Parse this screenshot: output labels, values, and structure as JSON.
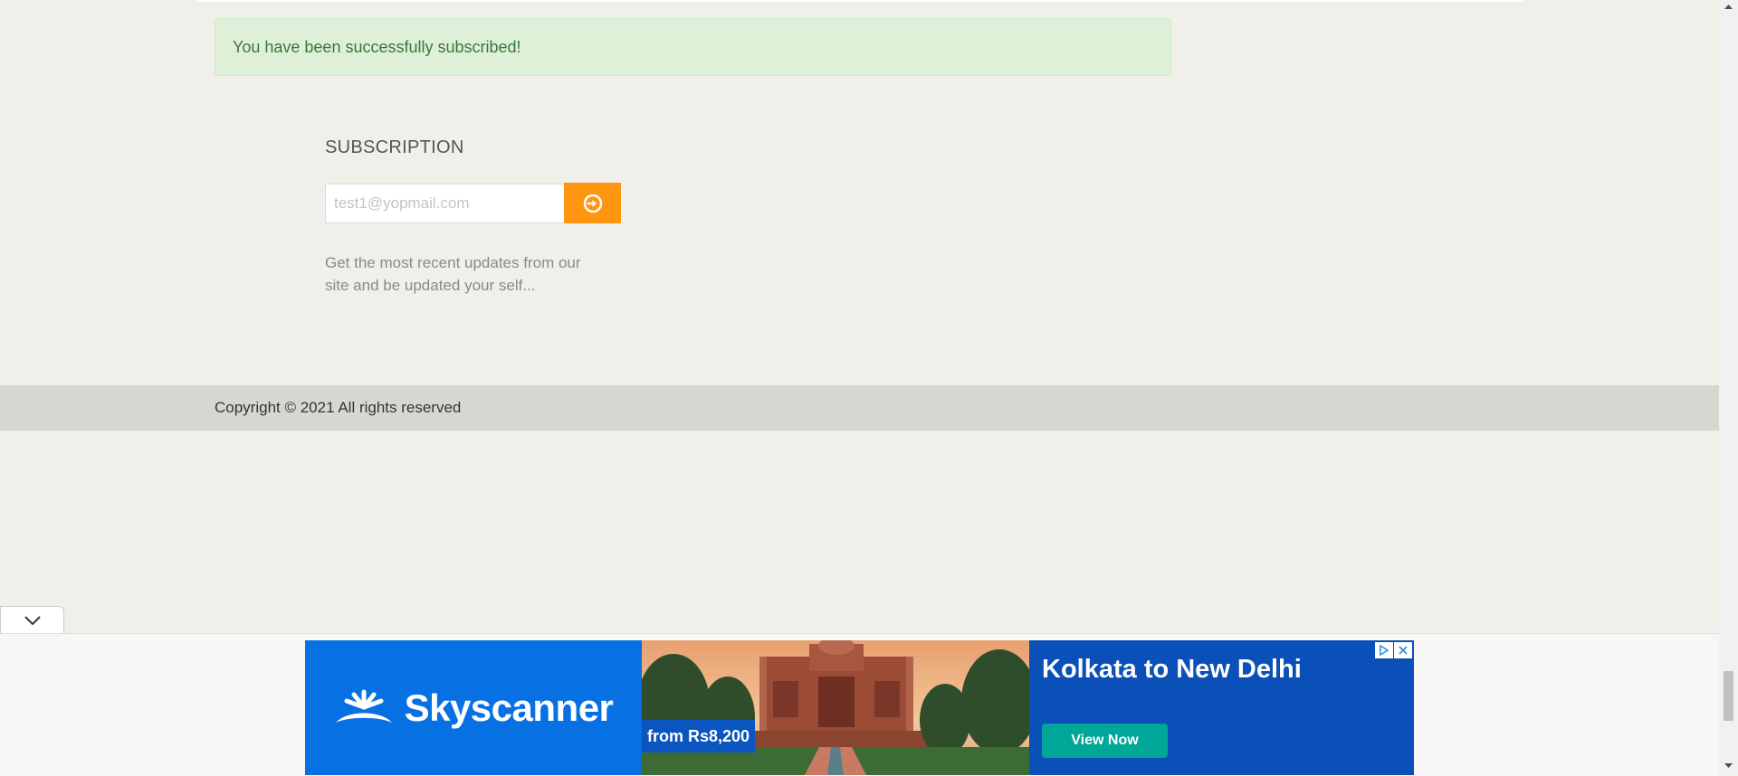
{
  "alert": {
    "message": "You have been successfully subscribed!"
  },
  "subscription": {
    "title": "SUBSCRIPTION",
    "email_value": "test1@yopmail.com",
    "submit_icon": "arrow-circle-right-icon",
    "description": "Get the most recent updates from our site and be updated your self..."
  },
  "footer": {
    "copyright": "Copyright © 2021 All rights reserved"
  },
  "collapse": {
    "icon": "chevron-down-icon"
  },
  "ad": {
    "brand": "Skyscanner",
    "price": "from Rs8,200",
    "route": "Kolkata to New Delhi",
    "cta": "View Now",
    "controls": [
      "adchoices-icon",
      "close-icon"
    ]
  },
  "colors": {
    "page_bg": "#f0efe9",
    "alert_bg": "#dff0d8",
    "alert_text": "#3c763d",
    "button_orange": "#ff9612",
    "footer_bar": "#d7d7d2",
    "ad_blue": "#0770e3",
    "cta_teal": "#00a698"
  }
}
